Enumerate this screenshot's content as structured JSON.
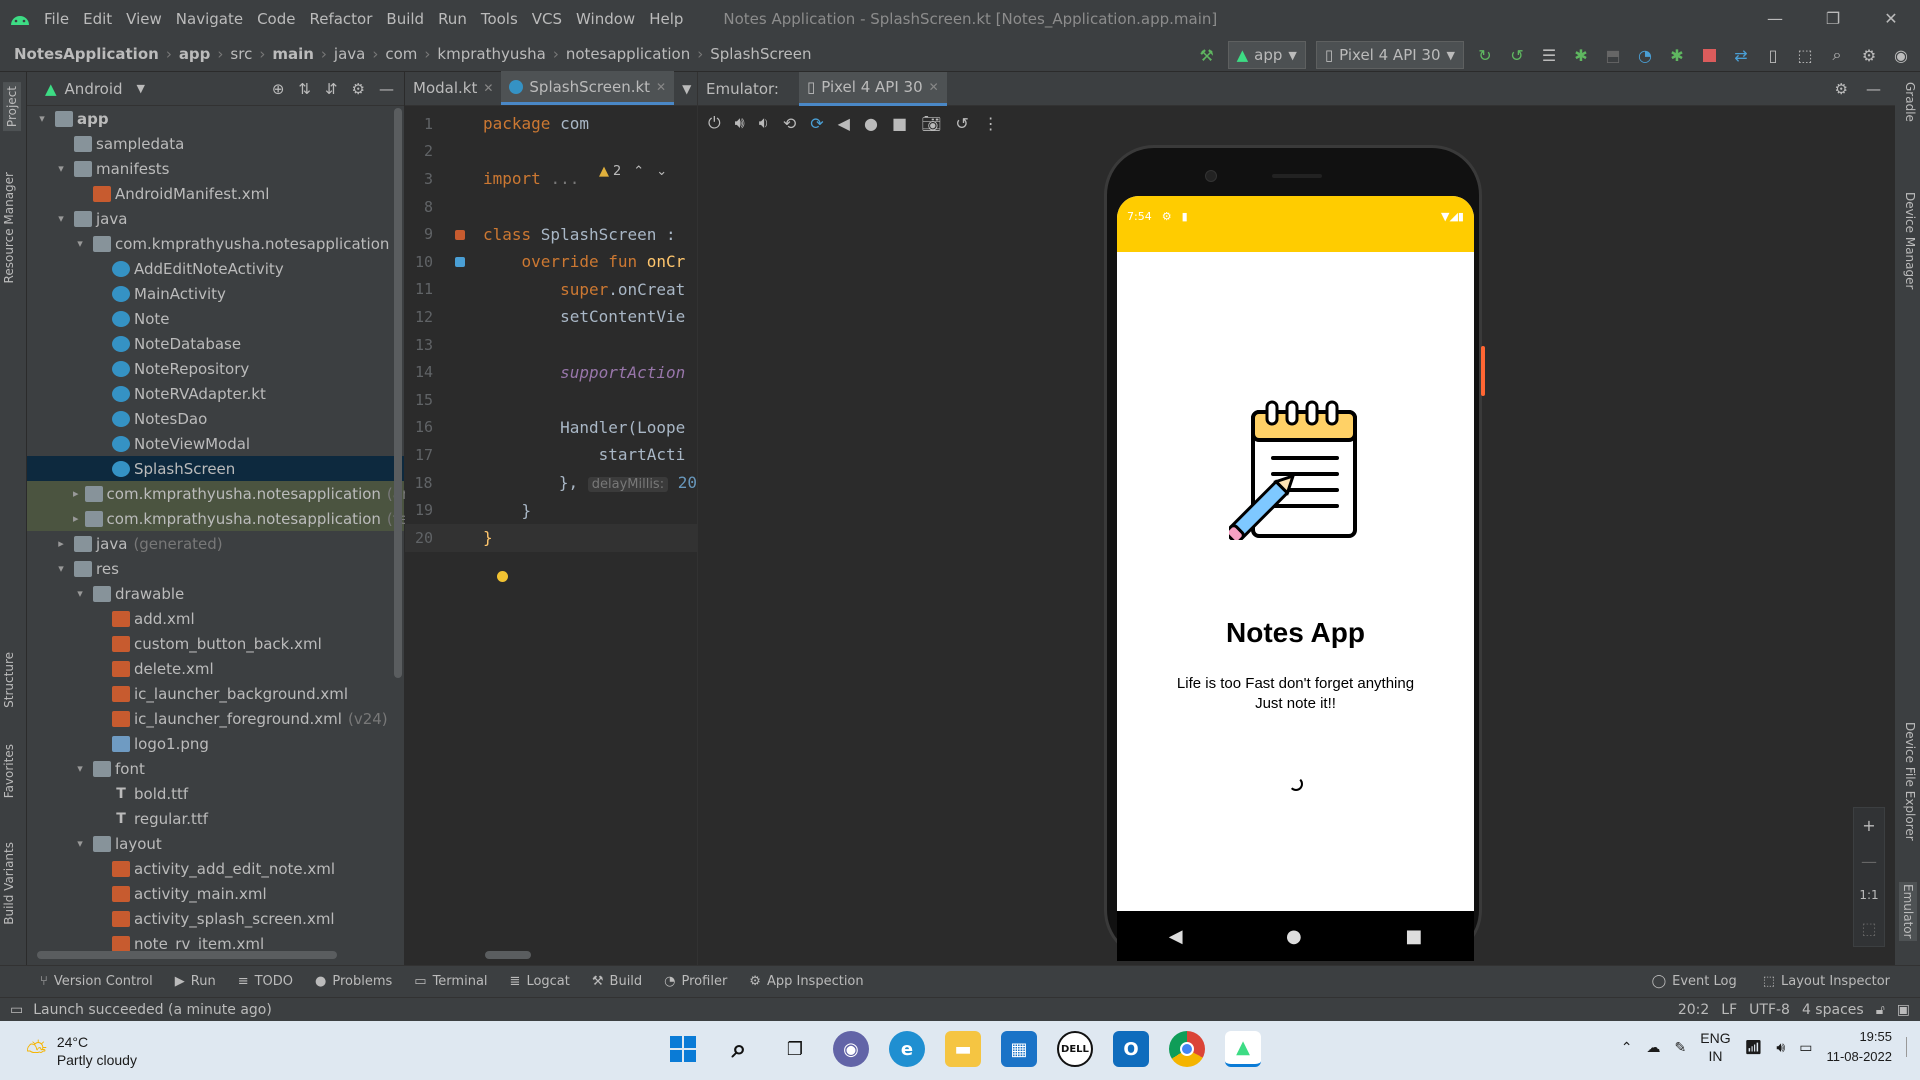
{
  "menu": {
    "items": [
      "File",
      "Edit",
      "View",
      "Navigate",
      "Code",
      "Refactor",
      "Build",
      "Run",
      "Tools",
      "VCS",
      "Window",
      "Help"
    ],
    "title": "Notes Application - SplashScreen.kt [Notes_Application.app.main]"
  },
  "breadcrumb": [
    "NotesApplication",
    "app",
    "src",
    "main",
    "java",
    "com",
    "kmprathyusha",
    "notesapplication",
    "SplashScreen"
  ],
  "toolbar": {
    "run_config": "app",
    "device": "Pixel 4 API 30"
  },
  "project_panel": {
    "view": "Android",
    "tree": [
      {
        "label": "app",
        "indent": 0,
        "arrow": "▾",
        "icon": "folder",
        "bold": true
      },
      {
        "label": "sampledata",
        "indent": 1,
        "arrow": "",
        "icon": "folder"
      },
      {
        "label": "manifests",
        "indent": 1,
        "arrow": "▾",
        "icon": "folder"
      },
      {
        "label": "AndroidManifest.xml",
        "indent": 2,
        "arrow": "",
        "icon": "xml"
      },
      {
        "label": "java",
        "indent": 1,
        "arrow": "▾",
        "icon": "folder"
      },
      {
        "label": "com.kmprathyusha.notesapplication",
        "indent": 2,
        "arrow": "▾",
        "icon": "folder"
      },
      {
        "label": "AddEditNoteActivity",
        "indent": 3,
        "arrow": "",
        "icon": "kclass"
      },
      {
        "label": "MainActivity",
        "indent": 3,
        "arrow": "",
        "icon": "kclass"
      },
      {
        "label": "Note",
        "indent": 3,
        "arrow": "",
        "icon": "kclass"
      },
      {
        "label": "NoteDatabase",
        "indent": 3,
        "arrow": "",
        "icon": "kclass"
      },
      {
        "label": "NoteRepository",
        "indent": 3,
        "arrow": "",
        "icon": "kclass"
      },
      {
        "label": "NoteRVAdapter.kt",
        "indent": 3,
        "arrow": "",
        "icon": "kclass"
      },
      {
        "label": "NotesDao",
        "indent": 3,
        "arrow": "",
        "icon": "kclass"
      },
      {
        "label": "NoteViewModal",
        "indent": 3,
        "arrow": "",
        "icon": "kclass"
      },
      {
        "label": "SplashScreen",
        "indent": 3,
        "arrow": "",
        "icon": "kclass",
        "selected": true
      },
      {
        "label": "com.kmprathyusha.notesapplication",
        "suffix": "(andr",
        "indent": 2,
        "arrow": "▸",
        "icon": "folder",
        "mod": true
      },
      {
        "label": "com.kmprathyusha.notesapplication",
        "suffix": "(test)",
        "indent": 2,
        "arrow": "▸",
        "icon": "folder",
        "mod": true
      },
      {
        "label": "java",
        "suffix": "(generated)",
        "indent": 1,
        "arrow": "▸",
        "icon": "folder"
      },
      {
        "label": "res",
        "indent": 1,
        "arrow": "▾",
        "icon": "folder"
      },
      {
        "label": "drawable",
        "indent": 2,
        "arrow": "▾",
        "icon": "folder"
      },
      {
        "label": "add.xml",
        "indent": 3,
        "arrow": "",
        "icon": "xml"
      },
      {
        "label": "custom_button_back.xml",
        "indent": 3,
        "arrow": "",
        "icon": "xml"
      },
      {
        "label": "delete.xml",
        "indent": 3,
        "arrow": "",
        "icon": "xml"
      },
      {
        "label": "ic_launcher_background.xml",
        "indent": 3,
        "arrow": "",
        "icon": "xml"
      },
      {
        "label": "ic_launcher_foreground.xml",
        "suffix": "(v24)",
        "indent": 3,
        "arrow": "",
        "icon": "xml"
      },
      {
        "label": "logo1.png",
        "indent": 3,
        "arrow": "",
        "icon": "png"
      },
      {
        "label": "font",
        "indent": 2,
        "arrow": "▾",
        "icon": "folder"
      },
      {
        "label": "bold.ttf",
        "indent": 3,
        "arrow": "",
        "icon": "ttf"
      },
      {
        "label": "regular.ttf",
        "indent": 3,
        "arrow": "",
        "icon": "ttf"
      },
      {
        "label": "layout",
        "indent": 2,
        "arrow": "▾",
        "icon": "folder"
      },
      {
        "label": "activity_add_edit_note.xml",
        "indent": 3,
        "arrow": "",
        "icon": "xml"
      },
      {
        "label": "activity_main.xml",
        "indent": 3,
        "arrow": "",
        "icon": "xml"
      },
      {
        "label": "activity_splash_screen.xml",
        "indent": 3,
        "arrow": "",
        "icon": "xml"
      },
      {
        "label": "note_rv_item.xml",
        "indent": 3,
        "arrow": "",
        "icon": "xml"
      }
    ]
  },
  "editor": {
    "tabs": [
      "Modal.kt",
      "SplashScreen.kt"
    ],
    "warnings": "2",
    "lines": [
      {
        "n": "1",
        "html": [
          [
            "kw",
            "package "
          ],
          [
            "pl",
            "com"
          ]
        ]
      },
      {
        "n": "2",
        "html": []
      },
      {
        "n": "3",
        "html": [
          [
            "kw",
            "import "
          ],
          [
            "gray",
            "..."
          ]
        ]
      },
      {
        "n": "8",
        "html": []
      },
      {
        "n": "9",
        "html": [
          [
            "kw",
            "class "
          ],
          [
            "pl",
            "SplashScreen :"
          ]
        ]
      },
      {
        "n": "10",
        "html": [
          [
            "pl",
            "    "
          ],
          [
            "kw",
            "override fun "
          ],
          [
            "fn",
            "onCr"
          ]
        ]
      },
      {
        "n": "11",
        "html": [
          [
            "pl",
            "        "
          ],
          [
            "kw",
            "super"
          ],
          [
            "pl",
            ".onCreat"
          ]
        ]
      },
      {
        "n": "12",
        "html": [
          [
            "pl",
            "        setContentVie"
          ]
        ]
      },
      {
        "n": "13",
        "html": []
      },
      {
        "n": "14",
        "html": [
          [
            "pl",
            "        "
          ],
          [
            "it",
            "supportAction"
          ]
        ]
      },
      {
        "n": "15",
        "html": []
      },
      {
        "n": "16",
        "html": [
          [
            "pl",
            "        Handler(Loope"
          ]
        ]
      },
      {
        "n": "17",
        "html": [
          [
            "pl",
            "            startActi"
          ]
        ]
      },
      {
        "n": "18",
        "html": [
          [
            "pl",
            "        }, "
          ],
          [
            "hint",
            "delayMillis:"
          ],
          [
            "num",
            " 20"
          ]
        ]
      },
      {
        "n": "19",
        "html": [
          [
            "pl",
            "    }"
          ]
        ]
      },
      {
        "n": "20",
        "html": [
          [
            "fn",
            "}"
          ]
        ]
      }
    ]
  },
  "emulator": {
    "label": "Emulator:",
    "device_tab": "Pixel 4 API 30",
    "status_time": "7:54",
    "app_title": "Notes App",
    "app_subtitle_1": "Life is too Fast don't forget anything",
    "app_subtitle_2": "Just note it!!",
    "zoom_ratio": "1:1"
  },
  "bottom_tools": [
    "Version Control",
    "Run",
    "TODO",
    "Problems",
    "Terminal",
    "Logcat",
    "Build",
    "Profiler",
    "App Inspection"
  ],
  "bottom_right_tools": [
    "Event Log",
    "Layout Inspector"
  ],
  "status": {
    "message": "Launch succeeded (a minute ago)",
    "position": "20:2",
    "line_sep": "LF",
    "encoding": "UTF-8",
    "indent": "4 spaces"
  },
  "left_strip": [
    "Project",
    "Resource Manager",
    "Structure",
    "Favorites",
    "Build Variants"
  ],
  "right_strip": [
    "Gradle",
    "Device Manager",
    "Device File Explorer",
    "Emulator"
  ],
  "taskbar": {
    "temp": "24°C",
    "weather": "Partly cloudy",
    "lang1": "ENG",
    "lang2": "IN",
    "time": "19:55",
    "date": "11-08-2022"
  },
  "colors": {
    "accent": "#ffcc00",
    "selection": "#0d293e",
    "tab_underline": "#4a88c7"
  }
}
